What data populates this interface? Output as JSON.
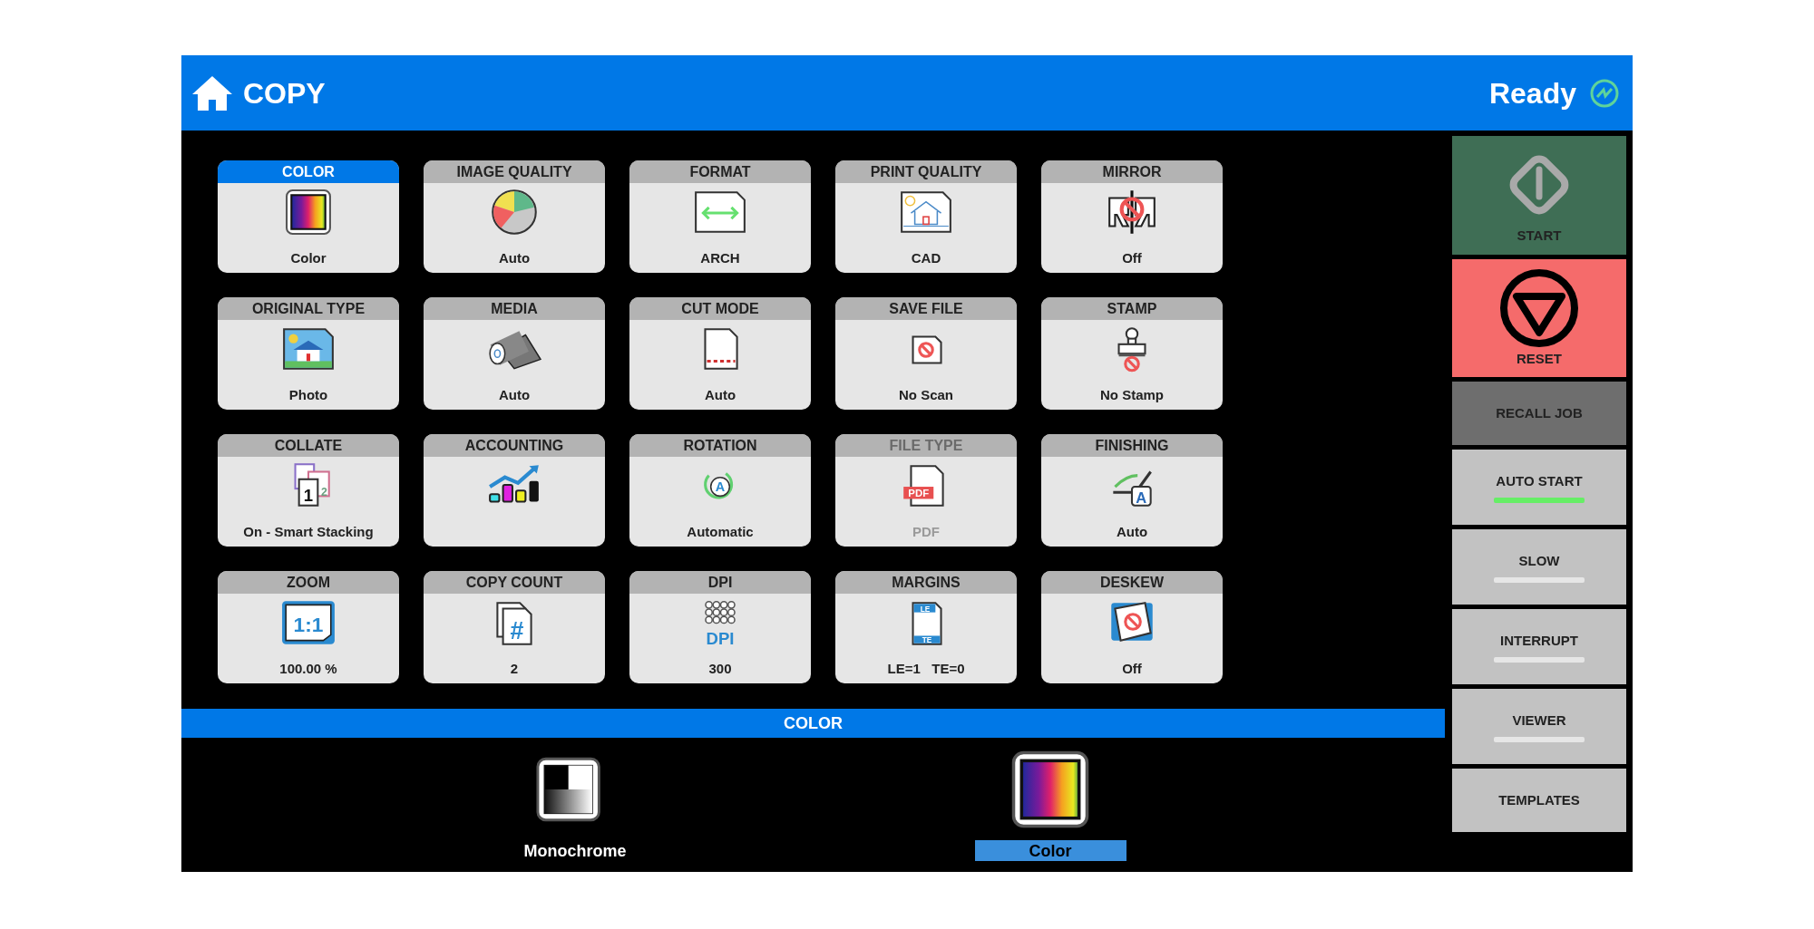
{
  "header": {
    "title": "COPY",
    "status": "Ready"
  },
  "tiles": [
    {
      "title": "COLOR",
      "value": "Color",
      "kind": "spectrum",
      "selected": true,
      "disabled": false
    },
    {
      "title": "IMAGE QUALITY",
      "value": "Auto",
      "kind": "pie",
      "selected": false,
      "disabled": false
    },
    {
      "title": "FORMAT",
      "value": "ARCH",
      "kind": "arrow-page",
      "selected": false,
      "disabled": false
    },
    {
      "title": "PRINT QUALITY",
      "value": "CAD",
      "kind": "house-page",
      "selected": false,
      "disabled": false
    },
    {
      "title": "MIRROR",
      "value": "Off",
      "kind": "mirror",
      "selected": false,
      "disabled": false
    },
    {
      "title": "ORIGINAL TYPE",
      "value": "Photo",
      "kind": "photo",
      "selected": false,
      "disabled": false
    },
    {
      "title": "MEDIA",
      "value": "Auto",
      "kind": "roll",
      "selected": false,
      "disabled": false
    },
    {
      "title": "CUT MODE",
      "value": "Auto",
      "kind": "cut-page",
      "selected": false,
      "disabled": false
    },
    {
      "title": "SAVE FILE",
      "value": "No Scan",
      "kind": "no-page",
      "selected": false,
      "disabled": false
    },
    {
      "title": "STAMP",
      "value": "No Stamp",
      "kind": "stamp",
      "selected": false,
      "disabled": false
    },
    {
      "title": "COLLATE",
      "value": "On - Smart Stacking",
      "kind": "collate",
      "icon_text": [
        "1",
        "2"
      ],
      "selected": false,
      "disabled": false
    },
    {
      "title": "ACCOUNTING",
      "kind": "chart",
      "selected": false,
      "disabled": false
    },
    {
      "title": "ROTATION",
      "value": "Automatic",
      "kind": "rotate",
      "icon_text": [
        "A"
      ],
      "selected": false,
      "disabled": false
    },
    {
      "title": "FILE TYPE",
      "value": "PDF",
      "kind": "pdf",
      "icon_text": [
        "PDF"
      ],
      "selected": false,
      "disabled": true
    },
    {
      "title": "FINISHING",
      "value": "Auto",
      "kind": "finishing",
      "icon_text": [
        "A"
      ],
      "selected": false,
      "disabled": false
    },
    {
      "title": "ZOOM",
      "value": "100.00 %",
      "kind": "zoom",
      "icon_text": [
        "1:1"
      ],
      "selected": false,
      "disabled": false
    },
    {
      "title": "COPY COUNT",
      "value": "2",
      "kind": "count",
      "icon_text": [
        "#"
      ],
      "selected": false,
      "disabled": false
    },
    {
      "title": "DPI",
      "value": "300",
      "kind": "dpi",
      "icon_text": [
        "DPI"
      ],
      "selected": false,
      "disabled": false
    },
    {
      "title": "MARGINS",
      "value": "LE=1   TE=0",
      "kind": "margins",
      "icon_text": [
        "LE",
        "TE"
      ],
      "selected": false,
      "disabled": false
    },
    {
      "title": "DESKEW",
      "value": "Off",
      "kind": "deskew",
      "selected": false,
      "disabled": false
    }
  ],
  "sidebar": [
    {
      "label": "START",
      "kind": "start"
    },
    {
      "label": "RESET",
      "kind": "reset"
    },
    {
      "label": "RECALL JOB",
      "kind": "dark"
    },
    {
      "label": "AUTO START",
      "kind": "toggle",
      "on": true
    },
    {
      "label": "SLOW",
      "kind": "toggle",
      "on": false
    },
    {
      "label": "INTERRUPT",
      "kind": "toggle",
      "on": false
    },
    {
      "label": "VIEWER",
      "kind": "toggle",
      "on": false
    },
    {
      "label": "TEMPLATES",
      "kind": "plain"
    }
  ],
  "panel": {
    "title": "COLOR",
    "options": [
      {
        "label": "Monochrome",
        "kind": "mono",
        "selected": false
      },
      {
        "label": "Color",
        "kind": "spectrum",
        "selected": true
      }
    ]
  }
}
